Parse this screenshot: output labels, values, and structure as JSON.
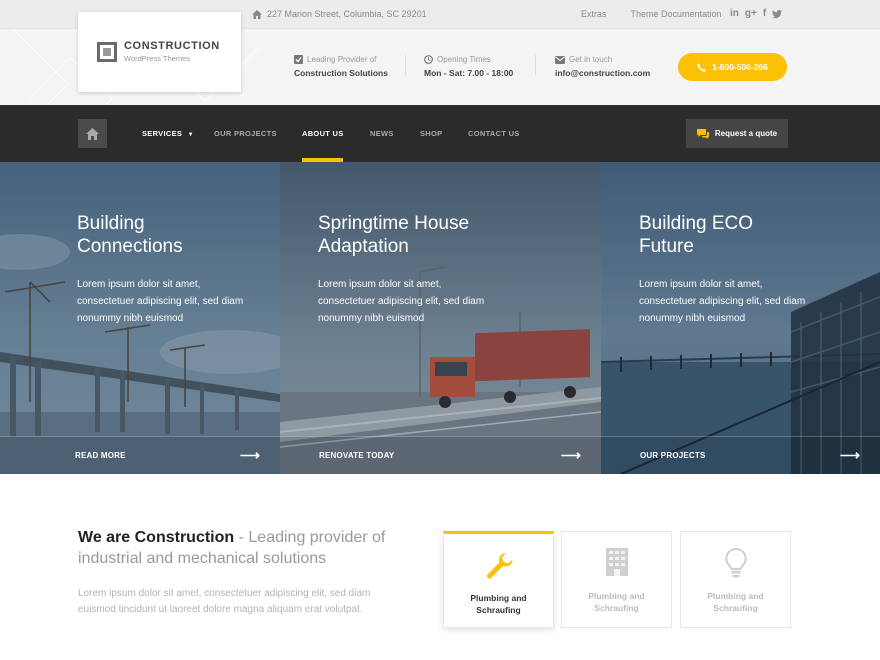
{
  "topbar": {
    "address": "227 Marion Street, Columbia, SC 29201",
    "links": [
      "Extras",
      "Theme Documentation"
    ],
    "social": [
      "in",
      "g+",
      "f",
      "t"
    ]
  },
  "logo": {
    "title": "CONSTRUCTION",
    "subtitle": "WordPress Themes"
  },
  "header_info": [
    {
      "label": "Leading Provider of",
      "value": "Construction Solutions",
      "icon": "check-square-icon"
    },
    {
      "label": "Opening Times",
      "value": "Mon - Sat: 7.00 - 18:00",
      "icon": "clock-icon"
    },
    {
      "label": "Get in touch",
      "value": "info@construction.com",
      "icon": "envelope-icon"
    }
  ],
  "phone": "1-800-506-266",
  "nav": {
    "items": [
      "SERVICES",
      "OUR PROJECTS",
      "ABOUT US",
      "NEWS",
      "SHOP",
      "CONTACT US"
    ],
    "active": "ABOUT US",
    "quote": "Request a quote"
  },
  "hero": [
    {
      "title1": "Building",
      "title2": "Connections",
      "desc": "Lorem ipsum dolor sit amet, consectetuer adipiscing elit, sed diam nonummy nibh euismod",
      "cta": "READ MORE"
    },
    {
      "title1": "Springtime House",
      "title2": "Adaptation",
      "desc": "Lorem ipsum dolor sit amet, consectetuer adipiscing elit, sed diam nonummy nibh euismod",
      "cta": "RENOVATE TODAY"
    },
    {
      "title1": "Building ECO",
      "title2": "Future",
      "desc": "Lorem ipsum dolor sit amet, consectetuer adipiscing elit, sed diam nonummy nibh euismod",
      "cta": "OUR PROJECTS"
    }
  ],
  "about": {
    "title_bold": "We are Construction",
    "title_rest": " - Leading provider of industrial and mechanical solutions",
    "desc": "Lorem ipsum dolor sit amet, consectetuer adipiscing elit, sed diam euismod tincidunt ut laoreet dolore magna aliquam erat volutpat."
  },
  "services": [
    {
      "label": "Plumbing and Schraufing",
      "icon": "wrench-icon"
    },
    {
      "label": "Plumbing and Schraufing",
      "icon": "building-icon"
    },
    {
      "label": "Plumbing and Schraufing",
      "icon": "lightbulb-icon"
    }
  ],
  "colors": {
    "accent": "#fcc105",
    "nav_bg": "#2b2b2b"
  }
}
